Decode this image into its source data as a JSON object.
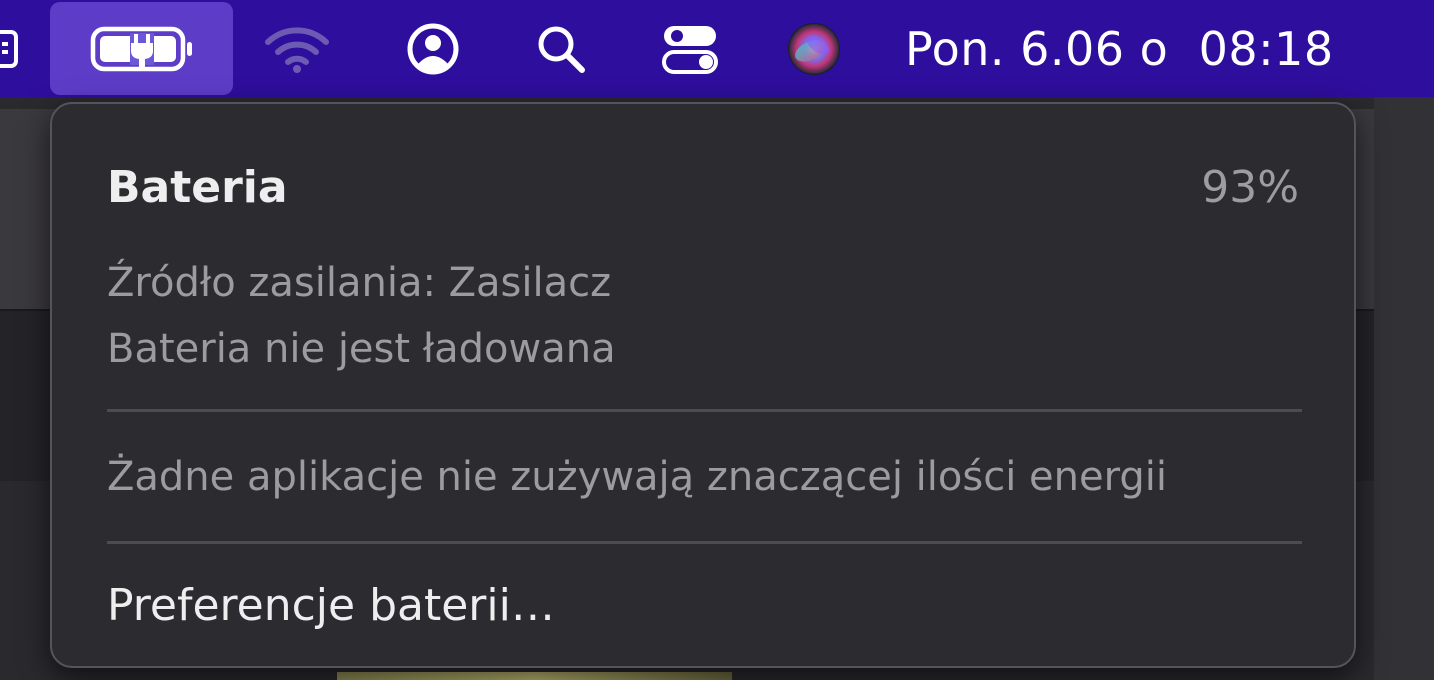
{
  "menubar": {
    "icons": [
      "calendar-icon",
      "battery-charging-icon",
      "wifi-icon",
      "user-icon",
      "search-icon",
      "control-center-icon",
      "siri-icon"
    ],
    "clock": "Pon. 6.06 o  08:18"
  },
  "battery_menu": {
    "title": "Bateria",
    "percent": "93%",
    "power_source": "Źródło zasilania: Zasilacz",
    "charging_status": "Bateria nie jest ładowana",
    "energy_usage": "Żadne aplikacje nie zużywają znaczącej ilości energii",
    "preferences_label": "Preferencje baterii…"
  },
  "colors": {
    "menubar_bg": "#2e0e9c",
    "menu_bg": "#2c2b30",
    "text_primary": "#eeeeee",
    "text_secondary": "#9c9ba0"
  }
}
